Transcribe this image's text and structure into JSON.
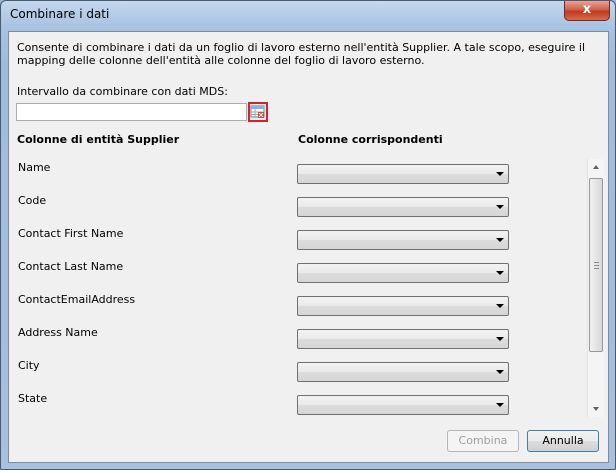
{
  "window": {
    "title": "Combinare i dati",
    "close_glyph": "x"
  },
  "intro_text": "Consente di combinare i dati da un foglio di lavoro esterno nell'entità Supplier. A tale scopo, eseguire il mapping delle colonne dell'entità alle colonne del foglio di lavoro esterno.",
  "range": {
    "label": "Intervallo da combinare con dati MDS:",
    "value": "",
    "button_icon": "range-select-icon"
  },
  "headers": {
    "left": "Colonne di entità Supplier",
    "right": "Colonne corrispondenti"
  },
  "rows": [
    {
      "label": "Name",
      "selected": ""
    },
    {
      "label": "Code",
      "selected": ""
    },
    {
      "label": "Contact First Name",
      "selected": ""
    },
    {
      "label": "Contact Last Name",
      "selected": ""
    },
    {
      "label": "ContactEmailAddress",
      "selected": ""
    },
    {
      "label": "Address Name",
      "selected": ""
    },
    {
      "label": "City",
      "selected": ""
    },
    {
      "label": "State",
      "selected": ""
    }
  ],
  "buttons": {
    "combine": "Combina",
    "cancel": "Annulla"
  },
  "colors": {
    "highlight_border": "#d3222a",
    "window_frame": "#a7c1de"
  }
}
